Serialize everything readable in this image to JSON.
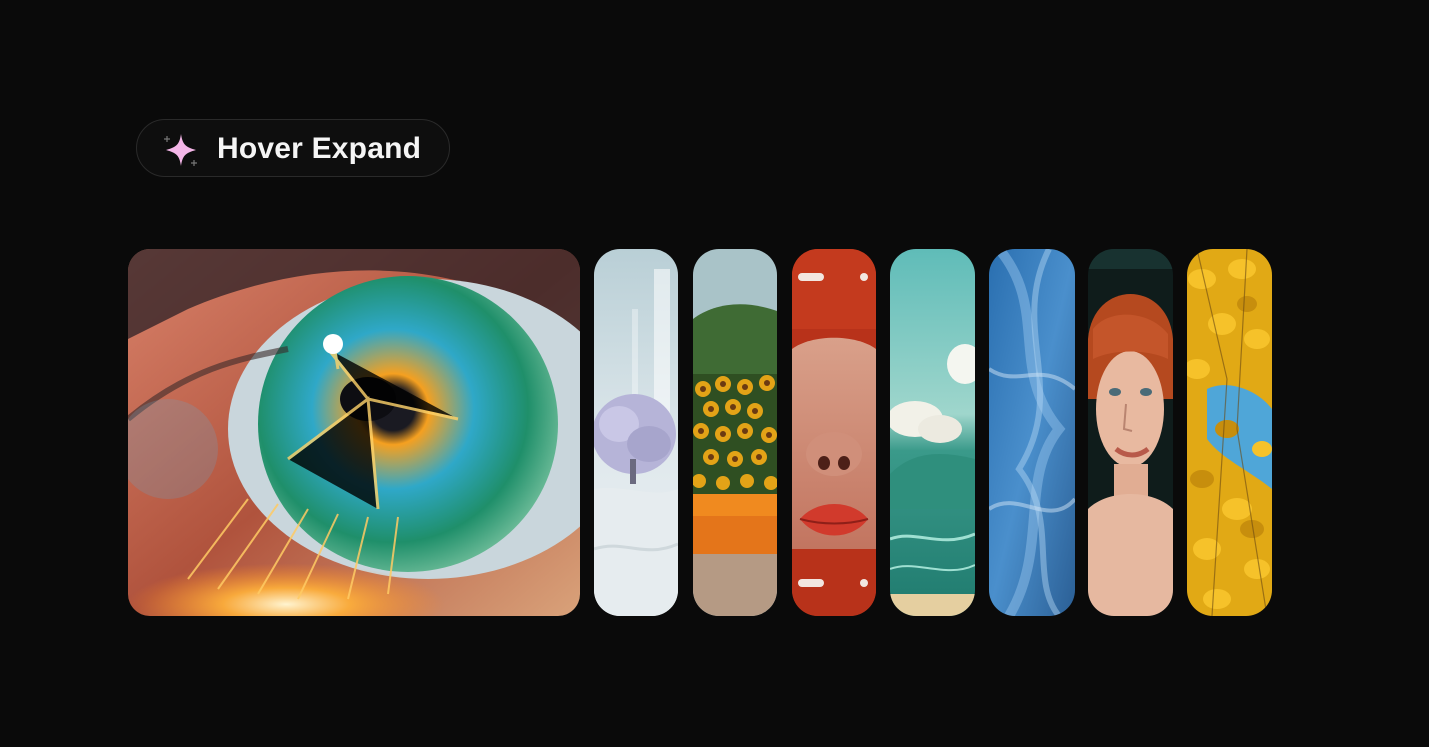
{
  "badge": {
    "icon": "sparkle-icon",
    "label": "Hover Expand",
    "accent_color": "#f4b6e8"
  },
  "gallery": {
    "expanded_index": 0,
    "panels": [
      {
        "icon": "eye-closeup-image"
      },
      {
        "icon": "snowy-tree-image"
      },
      {
        "icon": "sunflower-field-image"
      },
      {
        "icon": "red-lips-image"
      },
      {
        "icon": "ocean-wave-image"
      },
      {
        "icon": "blue-feathers-image"
      },
      {
        "icon": "redhead-portrait-image"
      },
      {
        "icon": "yellow-leaves-image"
      }
    ]
  }
}
